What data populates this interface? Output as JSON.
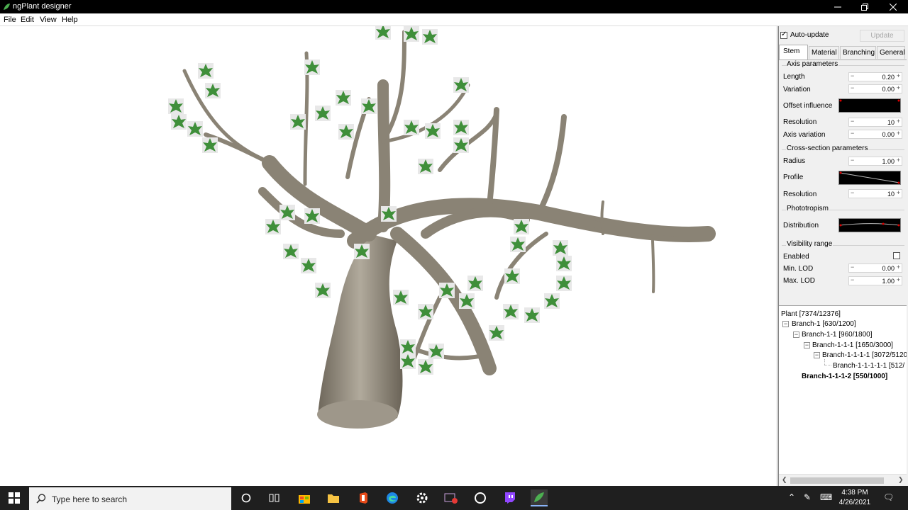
{
  "window": {
    "title": "ngPlant designer"
  },
  "menu": {
    "items": [
      "File",
      "Edit",
      "View",
      "Help"
    ]
  },
  "panel": {
    "auto_update_label": "Auto-update",
    "auto_update_checked": true,
    "update_label": "Update",
    "tabs": [
      "Stem",
      "Material",
      "Branching",
      "General"
    ],
    "active_tab": "Stem",
    "axis_group": {
      "title": "Axis parameters",
      "length_label": "Length",
      "length_value": "0.20",
      "variation_label": "Variation",
      "variation_value": "0.00",
      "offset_label": "Offset influence",
      "resolution_label": "Resolution",
      "resolution_value": "10",
      "axis_variation_label": "Axis variation",
      "axis_variation_value": "0.00"
    },
    "cross_group": {
      "title": "Cross-section parameters",
      "radius_label": "Radius",
      "radius_value": "1.00",
      "profile_label": "Profile",
      "resolution_label": "Resolution",
      "resolution_value": "10"
    },
    "photo_group": {
      "title": "Phototropism",
      "distribution_label": "Distribution"
    },
    "visibility_group": {
      "title": "Visibility range",
      "enabled_label": "Enabled",
      "enabled_checked": false,
      "min_lod_label": "Min. LOD",
      "min_lod_value": "0.00",
      "max_lod_label": "Max. LOD",
      "max_lod_value": "1.00"
    }
  },
  "tree": {
    "nodes": [
      "Plant [7374/12376]",
      "Branch-1 [630/1200]",
      "Branch-1-1 [960/1800]",
      "Branch-1-1-1 [1650/3000]",
      "Branch-1-1-1-1 [3072/5120",
      "Branch-1-1-1-1-1 [512/",
      "Branch-1-1-1-2 [550/1000]"
    ]
  },
  "taskbar": {
    "search_placeholder": "Type here to search",
    "time": "4:38 PM",
    "date": "4/26/2021"
  },
  "colors": {
    "leaf": "#3f8f3a",
    "bark": "#8a8375",
    "curve_bg": "#000000"
  }
}
